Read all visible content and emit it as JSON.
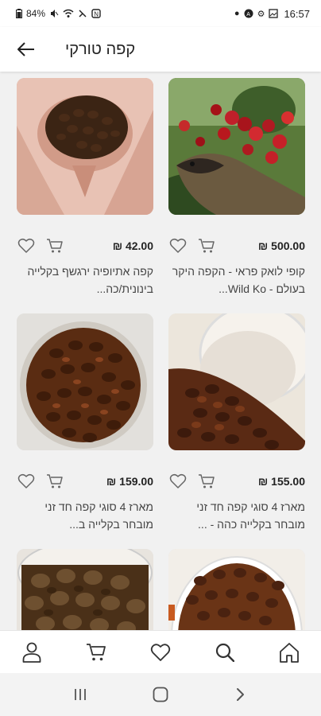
{
  "status_bar": {
    "battery": "84%",
    "time": "16:57",
    "icons": [
      "battery-icon",
      "wifi-icon",
      "mute-icon",
      "nfc-icon",
      "dot-icon",
      "app-icon",
      "settings-icon",
      "gallery-icon"
    ]
  },
  "header": {
    "back_icon": "arrow-left-icon",
    "title": "קפה טורקי"
  },
  "products": [
    {
      "price": "500.00 ₪",
      "title": "קופי לואק פראי - הקפה היקר בעולם - Wild Ko...",
      "image": "kopi-luwak-photo"
    },
    {
      "price": "42.00 ₪",
      "title": "קפה אתיופיה ירגשף בקלייה בינונית/כה...",
      "image": "beans-in-hands-photo"
    },
    {
      "price": "155.00 ₪",
      "title": "מארז 4 סוגי קפה חד זני מובחר בקלייה כהה - ...",
      "image": "beans-in-cup-photo"
    },
    {
      "price": "159.00 ₪",
      "title": "מארז 4 סוגי קפה חד זני מובחר בקלייה ב...",
      "image": "beans-in-bowl-photo"
    },
    {
      "price": "",
      "title": "",
      "image": "beans-closeup-photo"
    },
    {
      "price": "",
      "title": "",
      "image": "beans-in-jar-photo"
    }
  ],
  "card_icons": {
    "wishlist": "heart-icon",
    "cart": "cart-icon"
  },
  "bottom_nav": [
    {
      "name": "home",
      "icon": "home-icon"
    },
    {
      "name": "search",
      "icon": "search-icon"
    },
    {
      "name": "wishlist",
      "icon": "heart-icon"
    },
    {
      "name": "cart",
      "icon": "cart-icon"
    },
    {
      "name": "account",
      "icon": "user-icon"
    }
  ],
  "system_nav": [
    "recents-icon",
    "home-circle-icon",
    "back-chevron-icon"
  ],
  "colors": {
    "background": "#f1f1f1",
    "surface": "#ffffff",
    "text": "#222222",
    "icon": "#444444"
  }
}
